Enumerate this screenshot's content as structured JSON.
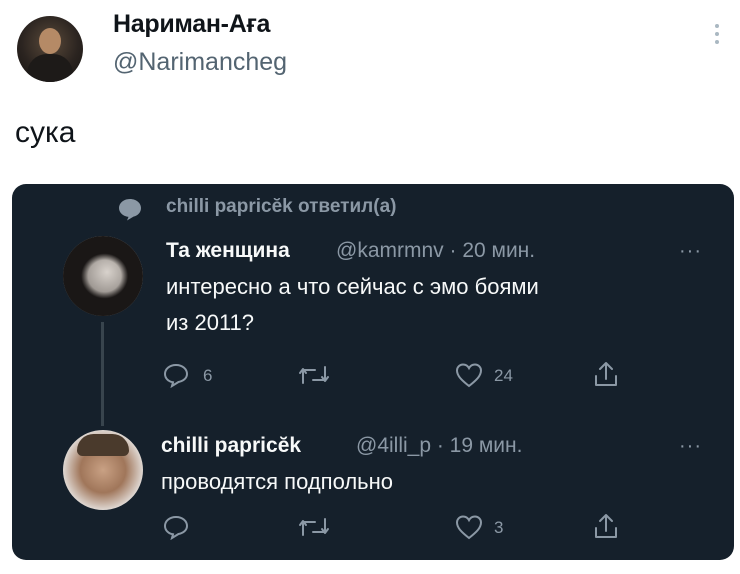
{
  "tweet": {
    "display_name": "Нариман-Ағa",
    "handle": "@Narimancheg",
    "text": "сука"
  },
  "quoted": {
    "reply_context": "chilli papricĕk ответил(а)",
    "post1": {
      "name": "Та женщина",
      "handle_time": "@kamrmnv · 20 мин.",
      "line1": "интересно а что сейчас с эмо боями",
      "line2": "из 2011?",
      "replies": "6",
      "likes": "24",
      "more": "···"
    },
    "post2": {
      "name": "chilli papricĕk",
      "handle_time": "@4illi_p · 19 мин.",
      "text": "проводятся подпольно",
      "likes": "3",
      "more": "···"
    }
  },
  "colors": {
    "card_bg": "#15202b",
    "muted": "#8b98a5",
    "text_dark": "#0f1419",
    "text_light": "#f7f9f9"
  },
  "icons": [
    "more-vertical-icon",
    "speech-bubble-icon",
    "reply-icon",
    "retweet-icon",
    "heart-icon",
    "share-icon",
    "more-horizontal-icon"
  ]
}
